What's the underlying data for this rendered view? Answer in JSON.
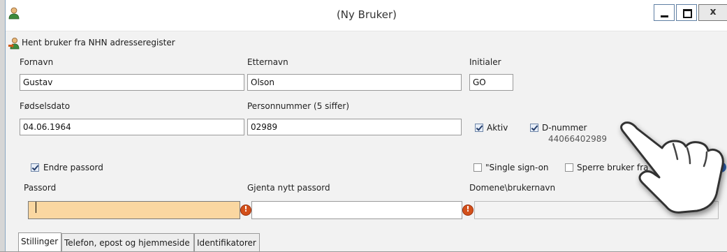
{
  "window": {
    "title": "(Ny Bruker)",
    "close_label": "x"
  },
  "toolbar": {
    "fetch_label": "Hent bruker fra NHN adresseregister"
  },
  "form": {
    "fornavn": {
      "label": "Fornavn",
      "value": "Gustav"
    },
    "etternavn": {
      "label": "Etternavn",
      "value": "Olson"
    },
    "initialer": {
      "label": "Initialer",
      "value": "GO"
    },
    "fodselsdato": {
      "label": "Fødselsdato",
      "value": "04.06.1964"
    },
    "personnummer": {
      "label": "Personnummer (5 siffer)",
      "value": "02989"
    },
    "aktiv": {
      "label": "Aktiv",
      "checked": true
    },
    "dnummer": {
      "label": "D-nummer",
      "checked": true,
      "value": "44066402989"
    },
    "endre_passord": {
      "label": "Endre passord",
      "checked": true
    },
    "single_sign_on": {
      "label": "\"Single sign-on",
      "checked": false
    },
    "sperre_bruker": {
      "label": "Sperre bruker fra",
      "checked": false
    },
    "passord": {
      "label": "Passord",
      "value": ""
    },
    "gjenta_passord": {
      "label": "Gjenta nytt passord",
      "value": ""
    },
    "domene": {
      "label": "Domene\\brukernavn",
      "value": ""
    }
  },
  "tabs": [
    {
      "label": "Stillinger",
      "active": true
    },
    {
      "label": "Telefon, epost og hjemmeside",
      "active": false
    },
    {
      "label": "Identifikatorer",
      "active": false
    }
  ],
  "icons": {
    "app": "user-icon",
    "fetch": "user-import-icon",
    "error": "error-icon",
    "help": "help-icon"
  },
  "colors": {
    "focused_field": "#fad7a1",
    "error": "#d3501a",
    "window_border": "#8aa6c1"
  }
}
